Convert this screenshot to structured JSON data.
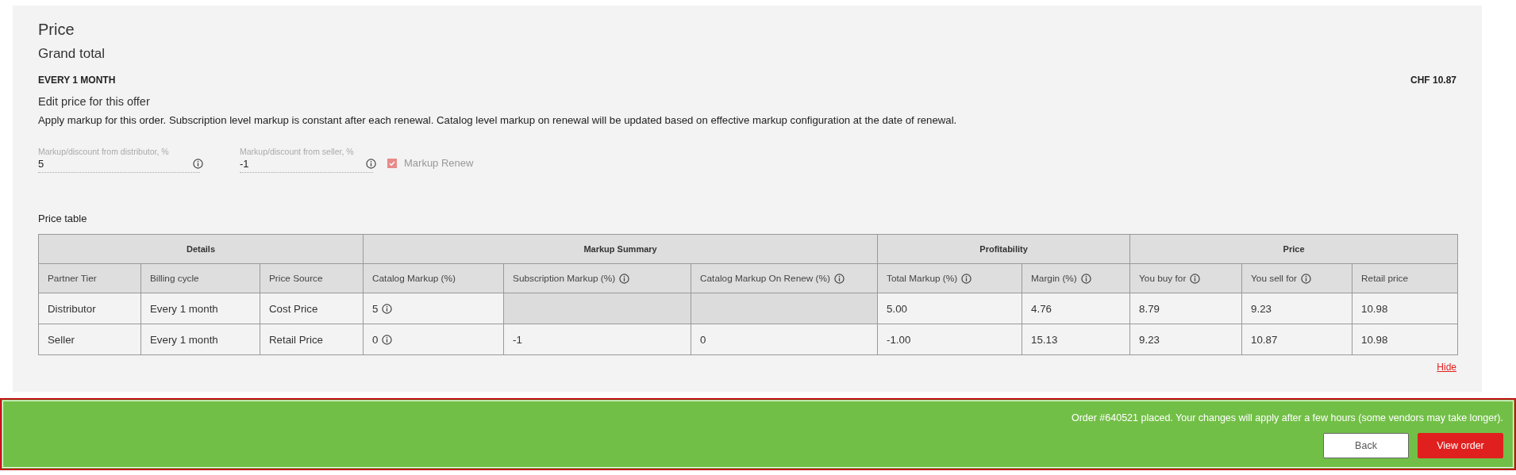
{
  "section": {
    "title": "Price",
    "subtitle": "Grand total",
    "period": "EVERY 1 MONTH",
    "total": "CHF 10.87",
    "edit_heading": "Edit price for this offer",
    "description": "Apply markup for this order. Subscription level markup is constant after each renewal. Catalog level markup on renewal will be updated based on effective markup configuration at the date of renewal."
  },
  "fields": [
    {
      "label": "Markup/discount from distributor, %",
      "value": "5"
    },
    {
      "label": "Markup/discount from seller, %",
      "value": "-1"
    }
  ],
  "markup_renew": {
    "label": "Markup Renew",
    "checked": true,
    "disabled": true
  },
  "price_table": {
    "title": "Price table",
    "groups": [
      {
        "label": "Details"
      },
      {
        "label": "Markup Summary"
      },
      {
        "label": "Profitability"
      },
      {
        "label": "Price"
      }
    ],
    "columns": [
      {
        "label": "Partner Tier",
        "info": false
      },
      {
        "label": "Billing cycle",
        "info": false
      },
      {
        "label": "Price Source",
        "info": false
      },
      {
        "label": "Catalog Markup (%)",
        "info": false
      },
      {
        "label": "Subscription Markup (%)",
        "info": true
      },
      {
        "label": "Catalog Markup On Renew (%)",
        "info": true
      },
      {
        "label": "Total Markup (%)",
        "info": true
      },
      {
        "label": "Margin (%)",
        "info": true
      },
      {
        "label": "You buy for",
        "info": true
      },
      {
        "label": "You sell for",
        "info": true
      },
      {
        "label": "Retail price",
        "info": false
      }
    ],
    "rows": [
      [
        {
          "kind": "text",
          "value": "Distributor"
        },
        {
          "kind": "text",
          "value": "Every 1 month"
        },
        {
          "kind": "text",
          "value": "Cost Price"
        },
        {
          "kind": "info",
          "value": "5"
        },
        {
          "kind": "empty"
        },
        {
          "kind": "empty"
        },
        {
          "kind": "text",
          "value": "5.00"
        },
        {
          "kind": "text",
          "value": "4.76"
        },
        {
          "kind": "text",
          "value": "8.79"
        },
        {
          "kind": "text",
          "value": "9.23"
        },
        {
          "kind": "text",
          "value": "10.98"
        }
      ],
      [
        {
          "kind": "text",
          "value": "Seller"
        },
        {
          "kind": "text",
          "value": "Every 1 month"
        },
        {
          "kind": "text",
          "value": "Retail Price"
        },
        {
          "kind": "info",
          "value": "0"
        },
        {
          "kind": "text",
          "value": "-1"
        },
        {
          "kind": "text",
          "value": "0"
        },
        {
          "kind": "text",
          "value": "-1.00"
        },
        {
          "kind": "text",
          "value": "15.13"
        },
        {
          "kind": "text",
          "value": "9.23"
        },
        {
          "kind": "text",
          "value": "10.87"
        },
        {
          "kind": "text",
          "value": "10.98"
        }
      ]
    ],
    "hide_link": "Hide"
  },
  "banner": {
    "message": "Order #640521 placed. Your changes will apply after a few hours (some vendors may take longer).",
    "buttons": [
      {
        "label": "Back",
        "kind": "secondary"
      },
      {
        "label": "View order",
        "kind": "primary"
      }
    ]
  }
}
